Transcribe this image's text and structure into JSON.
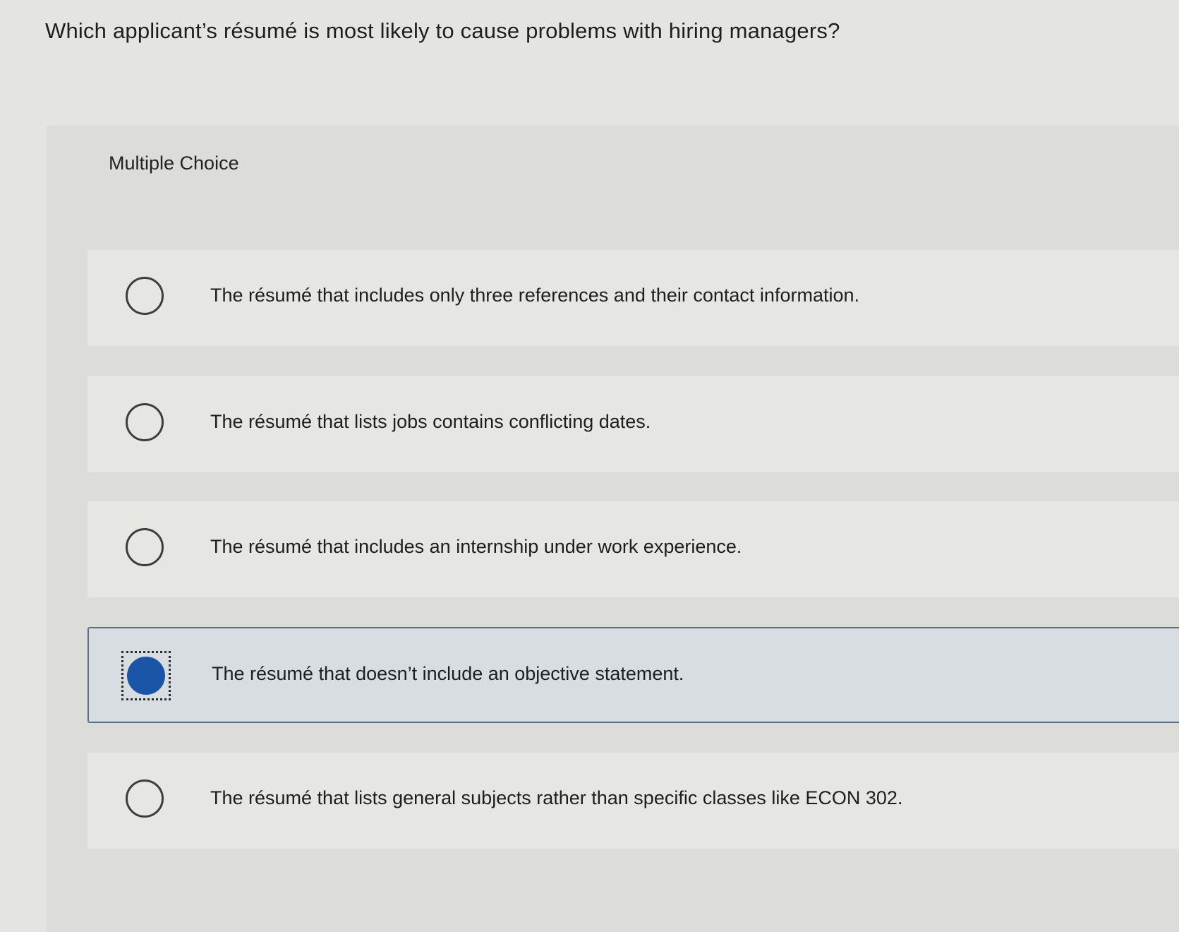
{
  "question": {
    "text": "Which applicant’s résumé is most likely to cause problems with hiring managers?"
  },
  "panel": {
    "label": "Multiple Choice"
  },
  "options": [
    {
      "text": "The résumé that includes only three references and their contact information.",
      "selected": false
    },
    {
      "text": "The résumé that lists jobs contains conflicting dates.",
      "selected": false
    },
    {
      "text": "The résumé that includes an internship under work experience.",
      "selected": false
    },
    {
      "text": "The résumé that doesn’t include an objective statement.",
      "selected": true
    },
    {
      "text": "The résumé that lists general subjects rather than specific classes like ECON 302.",
      "selected": false
    }
  ],
  "colors": {
    "selected_radio": "#1b55a8",
    "selected_border": "#5b6f86"
  }
}
